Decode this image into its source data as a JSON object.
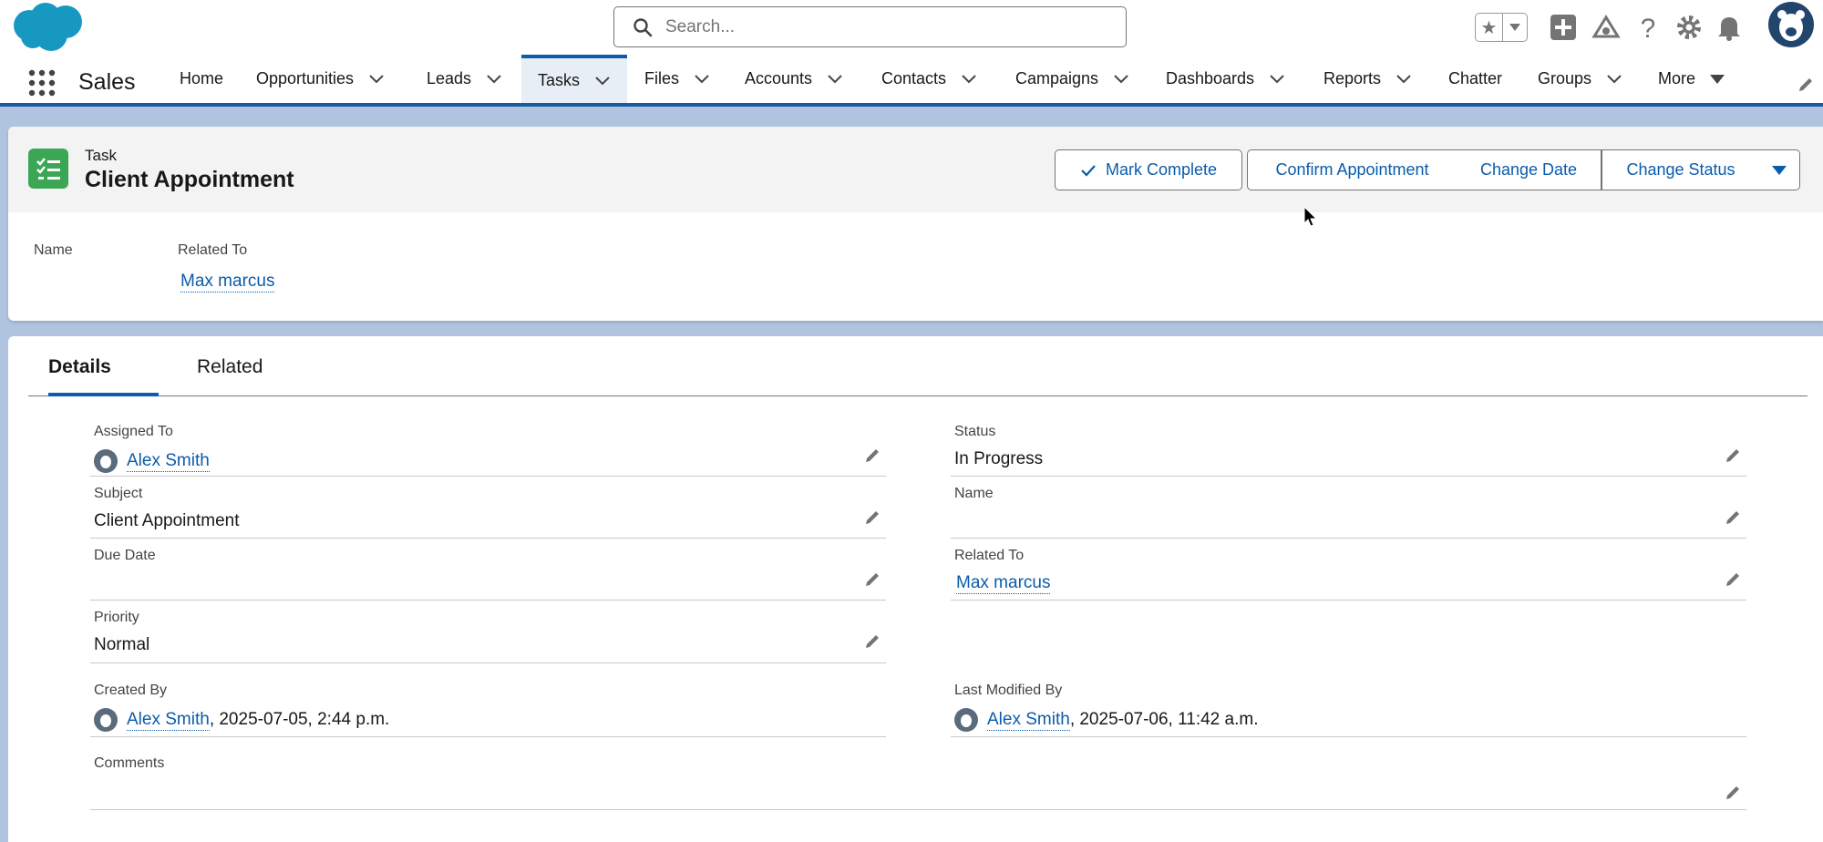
{
  "header": {
    "search_placeholder": "Search...",
    "icons": [
      "salesforce-cloud-logo",
      "favorites-star-icon",
      "add-icon",
      "trailhead-icon",
      "help-icon",
      "setup-gear-icon",
      "notifications-bell-icon",
      "user-avatar"
    ]
  },
  "nav": {
    "app_name": "Sales",
    "items": [
      {
        "label": "Home"
      },
      {
        "label": "Opportunities"
      },
      {
        "label": "Leads"
      },
      {
        "label": "Tasks"
      },
      {
        "label": "Files"
      },
      {
        "label": "Accounts"
      },
      {
        "label": "Contacts"
      },
      {
        "label": "Campaigns"
      },
      {
        "label": "Dashboards"
      },
      {
        "label": "Reports"
      },
      {
        "label": "Chatter"
      },
      {
        "label": "Groups"
      },
      {
        "label": "More"
      }
    ],
    "active": "Tasks"
  },
  "record": {
    "object_label": "Task",
    "title": "Client Appointment",
    "actions": {
      "mark_complete": "Mark Complete",
      "confirm_appointment": "Confirm Appointment",
      "change_date": "Change Date",
      "change_status": "Change Status"
    },
    "highlights": {
      "name_label": "Name",
      "related_to_label": "Related To",
      "related_to_value": "Max marcus"
    }
  },
  "tabs": {
    "details": "Details",
    "related": "Related"
  },
  "fields": {
    "assigned_to": {
      "label": "Assigned To",
      "value": "Alex Smith"
    },
    "status": {
      "label": "Status",
      "value": "In Progress"
    },
    "subject": {
      "label": "Subject",
      "value": "Client Appointment"
    },
    "name": {
      "label": "Name",
      "value": ""
    },
    "due_date": {
      "label": "Due Date",
      "value": ""
    },
    "related_to": {
      "label": "Related To",
      "value": "Max marcus"
    },
    "priority": {
      "label": "Priority",
      "value": "Normal"
    },
    "created_by": {
      "label": "Created By",
      "user": "Alex Smith",
      "timestamp": ", 2025-07-05, 2:44 p.m."
    },
    "last_modified_by": {
      "label": "Last Modified By",
      "user": "Alex Smith",
      "timestamp": ", 2025-07-06, 11:42 a.m."
    },
    "comments": {
      "label": "Comments",
      "value": ""
    }
  },
  "colors": {
    "brand_blue": "#0b5cab",
    "task_icon_green": "#3ba755",
    "nav_stripe": "#1b5aa0"
  }
}
